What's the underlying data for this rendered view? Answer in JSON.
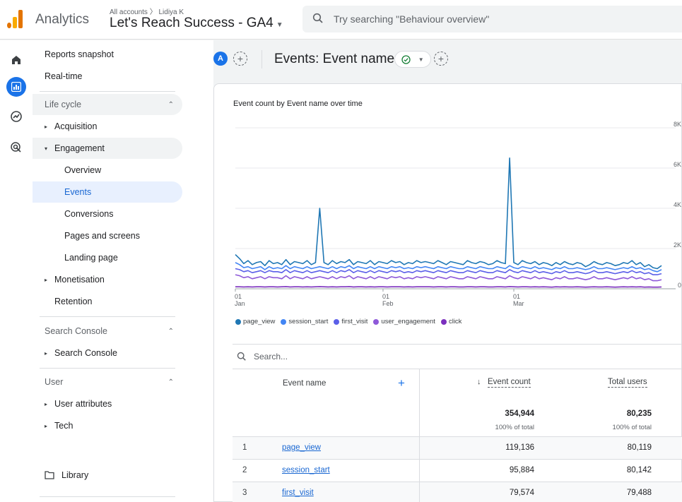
{
  "header": {
    "app_name": "Analytics",
    "accounts_crumb": "All accounts  〉 Lidiya K",
    "property_name": "Let's Reach Success - GA4",
    "search_placeholder": "Try searching \"Behaviour overview\""
  },
  "rail": {
    "icons": [
      "home-icon",
      "reports-icon",
      "explore-icon",
      "advertising-icon"
    ]
  },
  "nav": {
    "reports_snapshot": "Reports snapshot",
    "realtime": "Real-time",
    "lifecycle": "Life cycle",
    "acquisition": "Acquisition",
    "engagement": "Engagement",
    "overview": "Overview",
    "events": "Events",
    "conversions": "Conversions",
    "pages_screens": "Pages and screens",
    "landing_page": "Landing page",
    "monetisation": "Monetisation",
    "retention": "Retention",
    "search_console_section": "Search Console",
    "search_console": "Search Console",
    "user_section": "User",
    "user_attributes": "User attributes",
    "tech": "Tech",
    "library": "Library"
  },
  "main": {
    "comparison_badge": "A",
    "title": "Events: Event name"
  },
  "chart_data": {
    "type": "line",
    "title": "Event count by Event name over time",
    "x_ticks": [
      "01\nJan",
      "01\nFeb",
      "01\nMar"
    ],
    "y_ticks": [
      "8K",
      "6K",
      "4K",
      "2K",
      "0"
    ],
    "ylim": [
      0,
      8000
    ],
    "grid": true,
    "legend_position": "bottom-left",
    "series": [
      {
        "name": "page_view",
        "color": "#1f77b4",
        "values": [
          1700,
          1500,
          1250,
          1400,
          1200,
          1300,
          1350,
          1150,
          1400,
          1250,
          1300,
          1200,
          1450,
          1200,
          1350,
          1300,
          1250,
          1400,
          1200,
          1300,
          4000,
          1300,
          1200,
          1400,
          1250,
          1350,
          1300,
          1450,
          1200,
          1350,
          1300,
          1250,
          1400,
          1200,
          1350,
          1300,
          1250,
          1400,
          1300,
          1350,
          1200,
          1300,
          1250,
          1400,
          1300,
          1350,
          1300,
          1250,
          1400,
          1300,
          1200,
          1350,
          1300,
          1250,
          1200,
          1400,
          1300,
          1250,
          1350,
          1300,
          1200,
          1250,
          1400,
          1300,
          1250,
          6500,
          1300,
          1200,
          1400,
          1300,
          1250,
          1350,
          1200,
          1300,
          1250,
          1150,
          1300,
          1200,
          1350,
          1250,
          1200,
          1300,
          1250,
          1100,
          1200,
          1350,
          1250,
          1200,
          1300,
          1250,
          1150,
          1200,
          1300,
          1250,
          1400,
          1200,
          1300,
          1100,
          1200,
          1050,
          1000,
          1150
        ]
      },
      {
        "name": "session_start",
        "color": "#4285f4",
        "values": [
          1300,
          1200,
          1050,
          1100,
          1000,
          1050,
          1100,
          950,
          1100,
          1000,
          1050,
          1000,
          1150,
          1000,
          1100,
          1050,
          1000,
          1100,
          1000,
          1050,
          1100,
          1050,
          1000,
          1100,
          1000,
          1100,
          1050,
          1150,
          1000,
          1100,
          1050,
          1000,
          1100,
          1000,
          1100,
          1050,
          1000,
          1100,
          1050,
          1100,
          1000,
          1050,
          1000,
          1100,
          1050,
          1100,
          1050,
          1000,
          1100,
          1050,
          1000,
          1100,
          1050,
          1000,
          1000,
          1100,
          1050,
          1000,
          1100,
          1050,
          1000,
          1000,
          1100,
          1050,
          1000,
          1150,
          1050,
          1000,
          1100,
          1050,
          1000,
          1100,
          1000,
          1050,
          1000,
          950,
          1050,
          1000,
          1100,
          1000,
          1000,
          1050,
          1000,
          950,
          1000,
          1100,
          1000,
          1000,
          1050,
          1000,
          950,
          1000,
          1050,
          1000,
          1100,
          1000,
          1050,
          950,
          1000,
          900,
          850,
          950
        ]
      },
      {
        "name": "first_visit",
        "color": "#5b5fe8",
        "values": [
          1000,
          950,
          850,
          900,
          800,
          850,
          900,
          800,
          900,
          850,
          850,
          800,
          950,
          800,
          900,
          850,
          800,
          900,
          800,
          850,
          900,
          850,
          800,
          900,
          800,
          900,
          850,
          950,
          800,
          900,
          850,
          800,
          900,
          800,
          900,
          850,
          800,
          900,
          850,
          900,
          800,
          850,
          800,
          900,
          850,
          900,
          850,
          800,
          900,
          850,
          800,
          900,
          850,
          800,
          800,
          900,
          850,
          800,
          900,
          850,
          800,
          800,
          900,
          850,
          800,
          950,
          850,
          800,
          900,
          850,
          800,
          900,
          800,
          850,
          800,
          750,
          850,
          800,
          900,
          800,
          800,
          850,
          800,
          750,
          800,
          900,
          800,
          800,
          850,
          800,
          750,
          800,
          850,
          800,
          900,
          800,
          850,
          750,
          800,
          700,
          700,
          750
        ]
      },
      {
        "name": "user_engagement",
        "color": "#8e59d9",
        "values": [
          700,
          650,
          550,
          600,
          500,
          550,
          600,
          500,
          600,
          550,
          550,
          500,
          650,
          500,
          600,
          550,
          500,
          600,
          500,
          550,
          600,
          550,
          500,
          600,
          500,
          600,
          550,
          650,
          500,
          600,
          550,
          500,
          600,
          500,
          600,
          550,
          500,
          600,
          550,
          600,
          500,
          550,
          500,
          600,
          550,
          600,
          550,
          500,
          600,
          550,
          500,
          600,
          550,
          500,
          500,
          600,
          550,
          500,
          600,
          550,
          500,
          500,
          600,
          550,
          500,
          650,
          550,
          500,
          600,
          550,
          500,
          600,
          500,
          550,
          500,
          450,
          550,
          500,
          600,
          500,
          500,
          550,
          500,
          450,
          500,
          600,
          500,
          500,
          550,
          500,
          450,
          500,
          550,
          500,
          600,
          500,
          550,
          450,
          500,
          400,
          400,
          450
        ]
      },
      {
        "name": "click",
        "color": "#7b2fbe",
        "values": [
          100,
          100,
          90,
          100,
          90,
          100,
          100,
          90,
          100,
          100,
          90,
          100,
          110,
          90,
          100,
          100,
          90,
          100,
          90,
          100,
          110,
          100,
          90,
          100,
          90,
          100,
          100,
          110,
          90,
          100,
          100,
          90,
          100,
          90,
          100,
          100,
          90,
          100,
          100,
          100,
          90,
          100,
          90,
          100,
          100,
          100,
          100,
          90,
          100,
          100,
          90,
          100,
          100,
          90,
          90,
          100,
          100,
          90,
          100,
          100,
          90,
          90,
          100,
          100,
          90,
          110,
          100,
          90,
          100,
          100,
          90,
          100,
          90,
          100,
          90,
          80,
          100,
          90,
          100,
          90,
          90,
          100,
          90,
          80,
          90,
          100,
          90,
          90,
          100,
          90,
          80,
          90,
          100,
          90,
          100,
          90,
          100,
          80,
          90,
          80,
          80,
          90
        ]
      }
    ]
  },
  "table": {
    "search_placeholder": "Search...",
    "col_event_name": "Event name",
    "col_event_count": "Event count",
    "col_total_users": "Total users",
    "total_event_count": "354,944",
    "total_users": "80,235",
    "pct_event_count": "100% of total",
    "pct_users": "100% of total",
    "rows": [
      {
        "rank": "1",
        "name": "page_view",
        "event_count": "119,136",
        "users": "80,119"
      },
      {
        "rank": "2",
        "name": "session_start",
        "event_count": "95,884",
        "users": "80,142"
      },
      {
        "rank": "3",
        "name": "first_visit",
        "event_count": "79,574",
        "users": "79,488"
      }
    ]
  }
}
